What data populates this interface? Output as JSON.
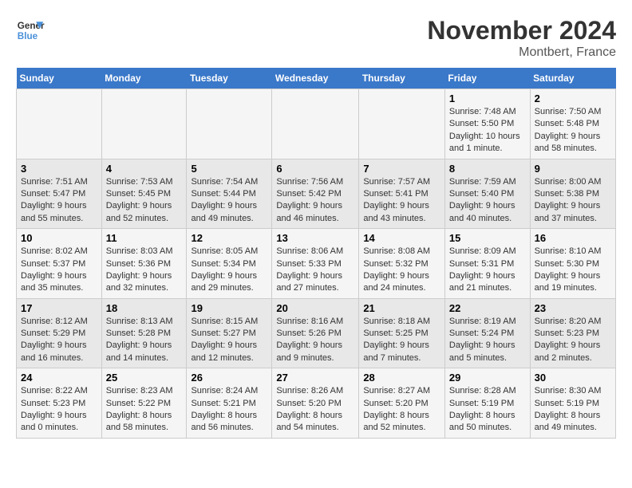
{
  "logo": {
    "line1": "General",
    "line2": "Blue"
  },
  "title": "November 2024",
  "location": "Montbert, France",
  "days_of_week": [
    "Sunday",
    "Monday",
    "Tuesday",
    "Wednesday",
    "Thursday",
    "Friday",
    "Saturday"
  ],
  "weeks": [
    [
      {
        "day": "",
        "info": ""
      },
      {
        "day": "",
        "info": ""
      },
      {
        "day": "",
        "info": ""
      },
      {
        "day": "",
        "info": ""
      },
      {
        "day": "",
        "info": ""
      },
      {
        "day": "1",
        "info": "Sunrise: 7:48 AM\nSunset: 5:50 PM\nDaylight: 10 hours and 1 minute."
      },
      {
        "day": "2",
        "info": "Sunrise: 7:50 AM\nSunset: 5:48 PM\nDaylight: 9 hours and 58 minutes."
      }
    ],
    [
      {
        "day": "3",
        "info": "Sunrise: 7:51 AM\nSunset: 5:47 PM\nDaylight: 9 hours and 55 minutes."
      },
      {
        "day": "4",
        "info": "Sunrise: 7:53 AM\nSunset: 5:45 PM\nDaylight: 9 hours and 52 minutes."
      },
      {
        "day": "5",
        "info": "Sunrise: 7:54 AM\nSunset: 5:44 PM\nDaylight: 9 hours and 49 minutes."
      },
      {
        "day": "6",
        "info": "Sunrise: 7:56 AM\nSunset: 5:42 PM\nDaylight: 9 hours and 46 minutes."
      },
      {
        "day": "7",
        "info": "Sunrise: 7:57 AM\nSunset: 5:41 PM\nDaylight: 9 hours and 43 minutes."
      },
      {
        "day": "8",
        "info": "Sunrise: 7:59 AM\nSunset: 5:40 PM\nDaylight: 9 hours and 40 minutes."
      },
      {
        "day": "9",
        "info": "Sunrise: 8:00 AM\nSunset: 5:38 PM\nDaylight: 9 hours and 37 minutes."
      }
    ],
    [
      {
        "day": "10",
        "info": "Sunrise: 8:02 AM\nSunset: 5:37 PM\nDaylight: 9 hours and 35 minutes."
      },
      {
        "day": "11",
        "info": "Sunrise: 8:03 AM\nSunset: 5:36 PM\nDaylight: 9 hours and 32 minutes."
      },
      {
        "day": "12",
        "info": "Sunrise: 8:05 AM\nSunset: 5:34 PM\nDaylight: 9 hours and 29 minutes."
      },
      {
        "day": "13",
        "info": "Sunrise: 8:06 AM\nSunset: 5:33 PM\nDaylight: 9 hours and 27 minutes."
      },
      {
        "day": "14",
        "info": "Sunrise: 8:08 AM\nSunset: 5:32 PM\nDaylight: 9 hours and 24 minutes."
      },
      {
        "day": "15",
        "info": "Sunrise: 8:09 AM\nSunset: 5:31 PM\nDaylight: 9 hours and 21 minutes."
      },
      {
        "day": "16",
        "info": "Sunrise: 8:10 AM\nSunset: 5:30 PM\nDaylight: 9 hours and 19 minutes."
      }
    ],
    [
      {
        "day": "17",
        "info": "Sunrise: 8:12 AM\nSunset: 5:29 PM\nDaylight: 9 hours and 16 minutes."
      },
      {
        "day": "18",
        "info": "Sunrise: 8:13 AM\nSunset: 5:28 PM\nDaylight: 9 hours and 14 minutes."
      },
      {
        "day": "19",
        "info": "Sunrise: 8:15 AM\nSunset: 5:27 PM\nDaylight: 9 hours and 12 minutes."
      },
      {
        "day": "20",
        "info": "Sunrise: 8:16 AM\nSunset: 5:26 PM\nDaylight: 9 hours and 9 minutes."
      },
      {
        "day": "21",
        "info": "Sunrise: 8:18 AM\nSunset: 5:25 PM\nDaylight: 9 hours and 7 minutes."
      },
      {
        "day": "22",
        "info": "Sunrise: 8:19 AM\nSunset: 5:24 PM\nDaylight: 9 hours and 5 minutes."
      },
      {
        "day": "23",
        "info": "Sunrise: 8:20 AM\nSunset: 5:23 PM\nDaylight: 9 hours and 2 minutes."
      }
    ],
    [
      {
        "day": "24",
        "info": "Sunrise: 8:22 AM\nSunset: 5:23 PM\nDaylight: 9 hours and 0 minutes."
      },
      {
        "day": "25",
        "info": "Sunrise: 8:23 AM\nSunset: 5:22 PM\nDaylight: 8 hours and 58 minutes."
      },
      {
        "day": "26",
        "info": "Sunrise: 8:24 AM\nSunset: 5:21 PM\nDaylight: 8 hours and 56 minutes."
      },
      {
        "day": "27",
        "info": "Sunrise: 8:26 AM\nSunset: 5:20 PM\nDaylight: 8 hours and 54 minutes."
      },
      {
        "day": "28",
        "info": "Sunrise: 8:27 AM\nSunset: 5:20 PM\nDaylight: 8 hours and 52 minutes."
      },
      {
        "day": "29",
        "info": "Sunrise: 8:28 AM\nSunset: 5:19 PM\nDaylight: 8 hours and 50 minutes."
      },
      {
        "day": "30",
        "info": "Sunrise: 8:30 AM\nSunset: 5:19 PM\nDaylight: 8 hours and 49 minutes."
      }
    ]
  ]
}
